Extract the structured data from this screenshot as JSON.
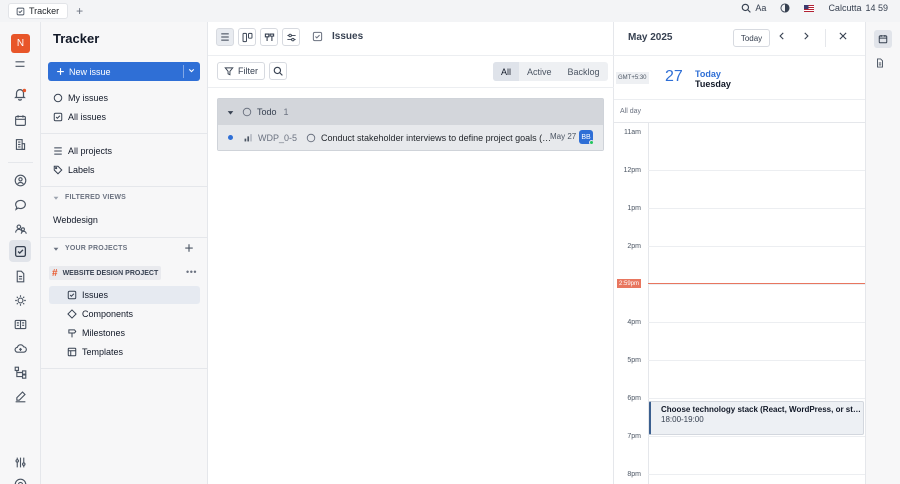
{
  "topbar": {
    "tab_label": "Tracker",
    "font_label": "Aa",
    "location": "Calcutta",
    "time": "14 59"
  },
  "rail": {
    "avatar_letter": "N"
  },
  "sidebar": {
    "title": "Tracker",
    "new_issue_label": "New issue",
    "my_issues": "My issues",
    "all_issues": "All issues",
    "all_projects": "All projects",
    "labels": "Labels",
    "filtered_views_heading": "FILTERED VIEWS",
    "webdesign": "Webdesign",
    "your_projects_heading": "YOUR PROJECTS",
    "project_name": "WEBSITE DESIGN PROJECT",
    "sub_items": [
      "Issues",
      "Components",
      "Milestones",
      "Templates"
    ]
  },
  "main": {
    "title": "Issues",
    "filter_label": "Filter",
    "segments": [
      "All",
      "Active",
      "Backlog"
    ],
    "active_segment": "All",
    "group": {
      "label": "Todo",
      "count": "1",
      "issue": {
        "id": "WDP_0-5",
        "title": "Conduct stakeholder interviews to define project goals (…",
        "date": "May 27",
        "assignee_initials": "BB"
      }
    }
  },
  "calendar": {
    "month": "May 2025",
    "today_button": "Today",
    "timezone": "GMT+5:30",
    "day_number": "27",
    "today_label": "Today",
    "weekday": "Tuesday",
    "all_day_label": "All day",
    "hours": [
      "11am",
      "12pm",
      "1pm",
      "2pm",
      "4pm",
      "5pm",
      "6pm",
      "7pm",
      "8pm"
    ],
    "now_label": "2:59pm",
    "event": {
      "title": "Choose technology stack (React, WordPress, or static…",
      "time": "18:00-19:00"
    }
  },
  "colors": {
    "brand_avatar": "#e8562a",
    "primary": "#2f6fd6",
    "now_line": "#e8765f",
    "event_accent": "#3b5f8f"
  }
}
